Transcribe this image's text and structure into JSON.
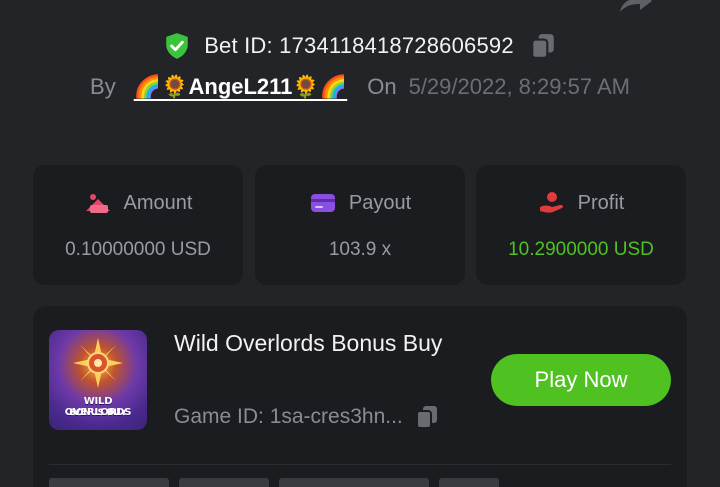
{
  "header": {
    "bet_id_label": "Bet ID: 1734118418728606592",
    "by_label": "By",
    "username": "🌈🌻AngeL211🌻🌈",
    "on_label": "On",
    "datetime": "5/29/2022, 8:29:57 AM"
  },
  "stats": {
    "amount": {
      "label": "Amount",
      "value": "0.10000000 USD"
    },
    "payout": {
      "label": "Payout",
      "value": "103.9 x"
    },
    "profit": {
      "label": "Profit",
      "value": "10.2900000 USD"
    }
  },
  "game": {
    "title": "Wild Overlords Bonus Buy",
    "thumbnail_line1": "WILD OVERLORDS",
    "thumbnail_line2": "BONUS BUY",
    "game_id_label": "Game ID: 1sa-cres3hn...",
    "play_button": "Play Now"
  },
  "colors": {
    "background": "#232427",
    "card": "#1b1c1f",
    "accent_green": "#4fc121",
    "amount_icon": "#e8456b",
    "payout_icon": "#8a4fe0",
    "profit_icon": "#e23a3a"
  },
  "icons": [
    "share-icon",
    "shield-check-icon",
    "copy-icon",
    "amount-icon",
    "payout-icon",
    "profit-icon"
  ]
}
